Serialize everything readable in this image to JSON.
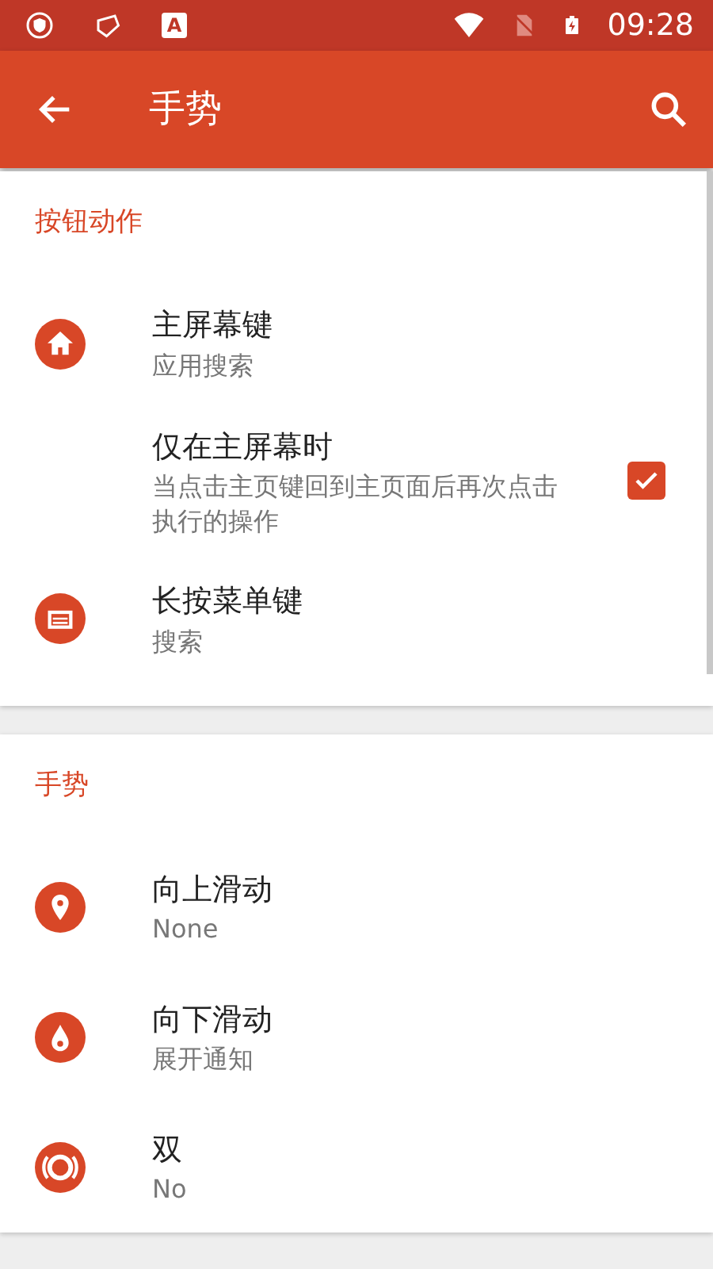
{
  "status_bar": {
    "app_letter": "A",
    "time": "09:28"
  },
  "app_bar": {
    "title": "手势"
  },
  "sections": [
    {
      "header": "按钮动作",
      "items": [
        {
          "kind": "icon",
          "title": "主屏幕键",
          "subtitle": "应用搜索"
        },
        {
          "kind": "checkbox",
          "title": "仅在主屏幕时",
          "subtitle": "当点击主页键回到主页面后再次点击执行的操作",
          "checked": true
        },
        {
          "kind": "icon",
          "title": "长按菜单键",
          "subtitle": "搜索"
        }
      ]
    },
    {
      "header": "手势",
      "items": [
        {
          "kind": "icon",
          "title": "向上滑动",
          "subtitle": "None"
        },
        {
          "kind": "icon",
          "title": "向下滑动",
          "subtitle": "展开通知"
        },
        {
          "kind": "icon",
          "title": "双",
          "subtitle": "No"
        }
      ]
    }
  ]
}
